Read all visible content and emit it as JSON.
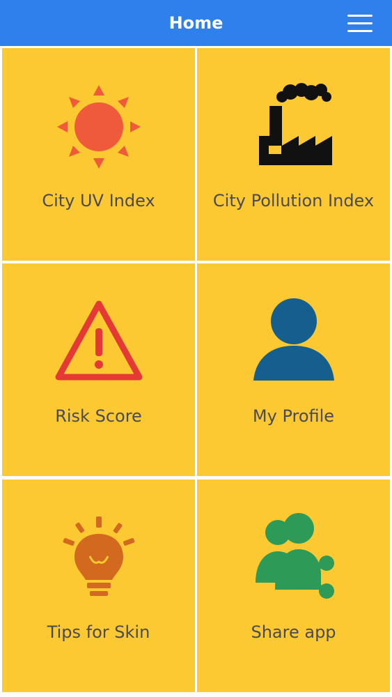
{
  "header": {
    "title": "Home",
    "menu_icon": "hamburger-menu-icon"
  },
  "tiles": [
    {
      "label": "City UV Index",
      "icon": "sun-icon",
      "color": "#ef5b3a"
    },
    {
      "label": "City Pollution Index",
      "icon": "factory-icon",
      "color": "#111111"
    },
    {
      "label": "Risk Score",
      "icon": "warning-icon",
      "color": "#e53935"
    },
    {
      "label": "My Profile",
      "icon": "user-icon",
      "color": "#155f8f"
    },
    {
      "label": "Tips for Skin",
      "icon": "lightbulb-icon",
      "color": "#d2691e"
    },
    {
      "label": "Share app",
      "icon": "share-users-icon",
      "color": "#2e9a57"
    }
  ],
  "colors": {
    "header_bg": "#2f80ed",
    "tile_bg": "#fcc933",
    "label_text": "#4a4a52"
  }
}
